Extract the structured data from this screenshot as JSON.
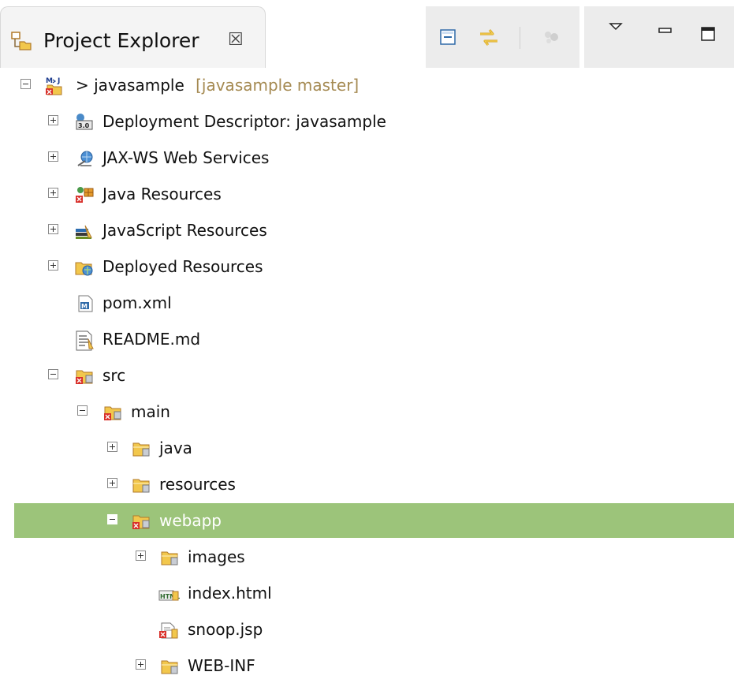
{
  "view": {
    "title": "Project Explorer",
    "close_glyph": "☒",
    "icon": "project-explorer-icon"
  },
  "toolbar": {
    "collapse_all": "collapse-all-icon",
    "link_with_editor": "link-with-editor-icon",
    "disabled_action": "disabled-filter-icon",
    "view_menu": "view-menu-icon",
    "minimize": "minimize-icon",
    "maximize": "maximize-icon"
  },
  "tree": {
    "project": {
      "prefix": "> ",
      "name": "javasample",
      "decoration": "[javasample master]"
    },
    "items": [
      {
        "label": "Deployment Descriptor: javasample",
        "icon": "deployment-descriptor-icon"
      },
      {
        "label": "JAX-WS Web Services",
        "icon": "web-services-icon"
      },
      {
        "label": "Java Resources",
        "icon": "java-resources-icon"
      },
      {
        "label": "JavaScript Resources",
        "icon": "javascript-resources-icon"
      },
      {
        "label": "Deployed Resources",
        "icon": "deployed-resources-icon"
      },
      {
        "label": "pom.xml",
        "icon": "maven-pom-icon"
      },
      {
        "label": "README.md",
        "icon": "text-file-icon"
      },
      {
        "label": "src",
        "icon": "folder-error-icon"
      },
      {
        "label": "main",
        "icon": "folder-error-icon"
      },
      {
        "label": "java",
        "icon": "folder-icon"
      },
      {
        "label": "resources",
        "icon": "folder-icon"
      },
      {
        "label": "webapp",
        "icon": "folder-error-icon"
      },
      {
        "label": "images",
        "icon": "folder-icon"
      },
      {
        "label": "index.html",
        "icon": "html-file-icon"
      },
      {
        "label": "snoop.jsp",
        "icon": "jsp-file-icon"
      },
      {
        "label": "WEB-INF",
        "icon": "folder-icon"
      }
    ]
  },
  "colors": {
    "selection": "#9cc47a",
    "decoration_text": "#a58a52",
    "folder": "#f2c74c",
    "error": "#d8302a"
  }
}
